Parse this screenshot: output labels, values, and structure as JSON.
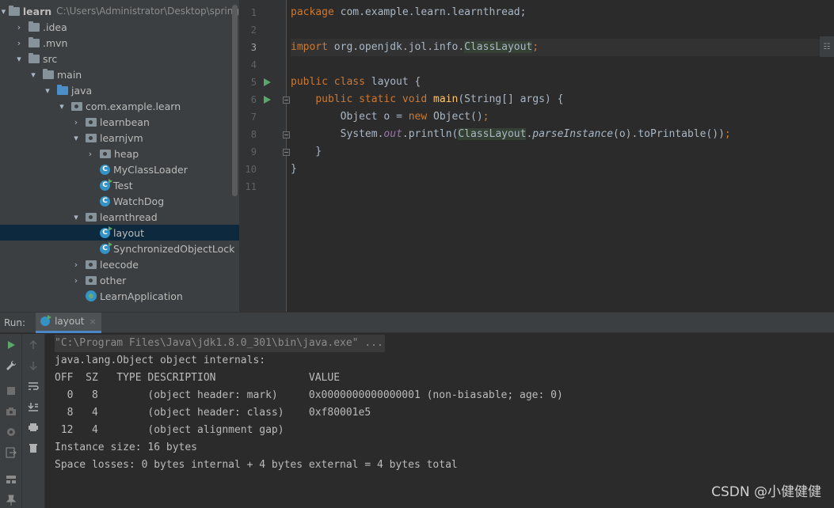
{
  "project_tree": {
    "root": {
      "label": "learn",
      "path": "C:\\Users\\Administrator\\Desktop\\spring"
    },
    "items": [
      {
        "label": ".idea"
      },
      {
        "label": ".mvn"
      },
      {
        "label": "src"
      },
      {
        "label": "main"
      },
      {
        "label": "java"
      },
      {
        "label": "com.example.learn"
      },
      {
        "label": "learnbean"
      },
      {
        "label": "learnjvm"
      },
      {
        "label": "heap"
      },
      {
        "label": "MyClassLoader",
        "icon_letter": "C"
      },
      {
        "label": "Test",
        "icon_letter": "C"
      },
      {
        "label": "WatchDog",
        "icon_letter": "C"
      },
      {
        "label": "learnthread"
      },
      {
        "label": "layout",
        "icon_letter": "C"
      },
      {
        "label": "SynchronizedObjectLock",
        "icon_letter": "C"
      },
      {
        "label": "leecode"
      },
      {
        "label": "other"
      },
      {
        "label": "LearnApplication"
      }
    ]
  },
  "editor": {
    "line_numbers": [
      "1",
      "2",
      "3",
      "4",
      "5",
      "6",
      "7",
      "8",
      "9",
      "10",
      "11"
    ],
    "code": {
      "l1_kw": "package",
      "l1_rest": " com.example.learn.learnthread;",
      "l3_kw": "import",
      "l3_pkg": " org.openjdk.jol.info.",
      "l3_cls": "ClassLayout",
      "l3_semi": ";",
      "l5_kw": "public class",
      "l5_rest": " layout {",
      "l6_indent": "    ",
      "l6_kw": "public static void",
      "l6_sp": " ",
      "l6_fn": "main",
      "l6_rest": "(String[] args) {",
      "l7_indent": "        ",
      "l7_a": "Object o = ",
      "l7_kw": "new",
      "l7_b": " Object()",
      "l7_semi": ";",
      "l8_indent": "        ",
      "l8_a": "System.",
      "l8_out": "out",
      "l8_b": ".println(",
      "l8_cls": "ClassLayout",
      "l8_c": ".",
      "l8_m": "parseInstance",
      "l8_d": "(o).toPrintable())",
      "l8_semi": ";",
      "l9": "    }",
      "l10": "}"
    },
    "hint_button": "☷"
  },
  "run_panel": {
    "label": "Run:",
    "tab_label": "layout",
    "tab_close": "×",
    "console_lines": [
      "\"C:\\Program Files\\Java\\jdk1.8.0_301\\bin\\java.exe\" ...",
      "java.lang.Object object internals:",
      "OFF  SZ   TYPE DESCRIPTION               VALUE",
      "  0   8        (object header: mark)     0x0000000000000001 (non-biasable; age: 0)",
      "  8   4        (object header: class)    0xf80001e5",
      " 12   4        (object alignment gap)    ",
      "Instance size: 16 bytes",
      "Space losses: 0 bytes internal + 4 bytes external = 4 bytes total"
    ]
  },
  "watermark": "CSDN @小健健健"
}
